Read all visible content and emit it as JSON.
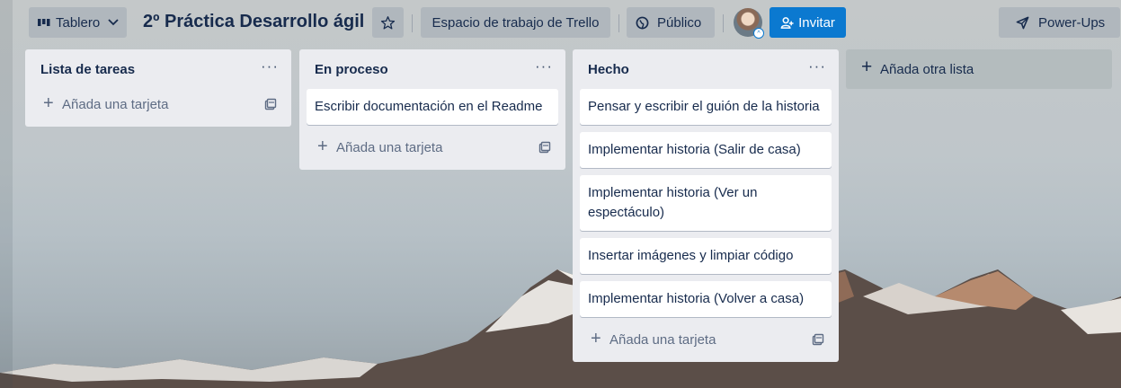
{
  "header": {
    "view_label": "Tablero",
    "board_title": "2º Práctica Desarrollo ágil",
    "workspace_label": "Espacio de trabajo de Trello",
    "visibility_label": "Público",
    "invite_label": "Invitar",
    "powerups_label": "Power-Ups"
  },
  "lists": [
    {
      "title": "Lista de tareas",
      "cards": [],
      "add_card_label": "Añada una tarjeta"
    },
    {
      "title": "En proceso",
      "cards": [
        "Escribir documentación en el Readme"
      ],
      "add_card_label": "Añada una tarjeta"
    },
    {
      "title": "Hecho",
      "cards": [
        "Pensar y escribir el guión de la historia",
        "Implementar historia (Salir de casa)",
        "Implementar historia (Ver un espectáculo)",
        "Insertar imágenes y limpiar código",
        "Implementar historia (Volver a casa)"
      ],
      "add_card_label": "Añada una tarjeta"
    }
  ],
  "add_list_label": "Añada otra lista",
  "colors": {
    "accent": "#0b79d0",
    "list_bg": "#ebecf0",
    "text": "#172b4d"
  }
}
